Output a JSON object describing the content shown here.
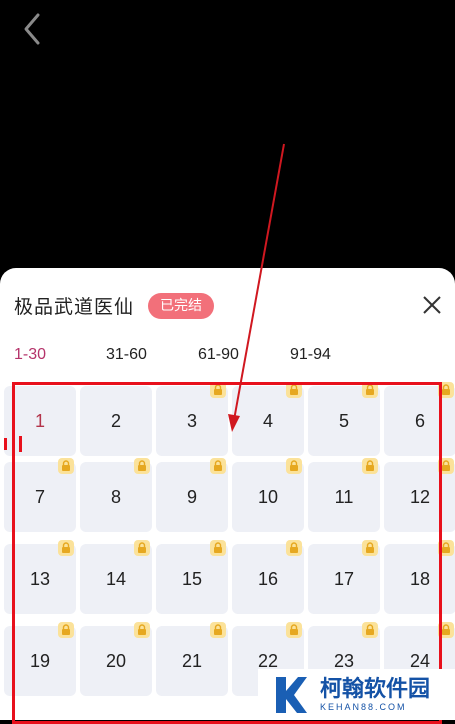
{
  "header": {
    "back_icon": "chevron-left-icon"
  },
  "sheet": {
    "title": "极品武道医仙",
    "status_badge": "已完结",
    "close_icon": "close-icon"
  },
  "tabs": [
    {
      "label": "1-30",
      "active": true
    },
    {
      "label": "31-60",
      "active": false
    },
    {
      "label": "61-90",
      "active": false
    },
    {
      "label": "91-94",
      "active": false
    }
  ],
  "chapters": [
    {
      "number": "1",
      "locked": false,
      "current": true
    },
    {
      "number": "2",
      "locked": false
    },
    {
      "number": "3",
      "locked": true
    },
    {
      "number": "4",
      "locked": true
    },
    {
      "number": "5",
      "locked": true
    },
    {
      "number": "6",
      "locked": true
    },
    {
      "number": "7",
      "locked": true
    },
    {
      "number": "8",
      "locked": true
    },
    {
      "number": "9",
      "locked": true
    },
    {
      "number": "10",
      "locked": true
    },
    {
      "number": "11",
      "locked": true
    },
    {
      "number": "12",
      "locked": true
    },
    {
      "number": "13",
      "locked": true
    },
    {
      "number": "14",
      "locked": true
    },
    {
      "number": "15",
      "locked": true
    },
    {
      "number": "16",
      "locked": true
    },
    {
      "number": "17",
      "locked": true
    },
    {
      "number": "18",
      "locked": true
    },
    {
      "number": "19",
      "locked": true
    },
    {
      "number": "20",
      "locked": true
    },
    {
      "number": "21",
      "locked": true
    },
    {
      "number": "22",
      "locked": true
    },
    {
      "number": "23",
      "locked": true
    },
    {
      "number": "24",
      "locked": true
    }
  ],
  "colors": {
    "badge": "#f2707a",
    "active_tab": "#b5336a",
    "annotation": "#e8101c",
    "lock_badge": "#fbe29a"
  },
  "watermark": {
    "name": "柯翰软件园",
    "site": "KEHAN88.COM"
  }
}
